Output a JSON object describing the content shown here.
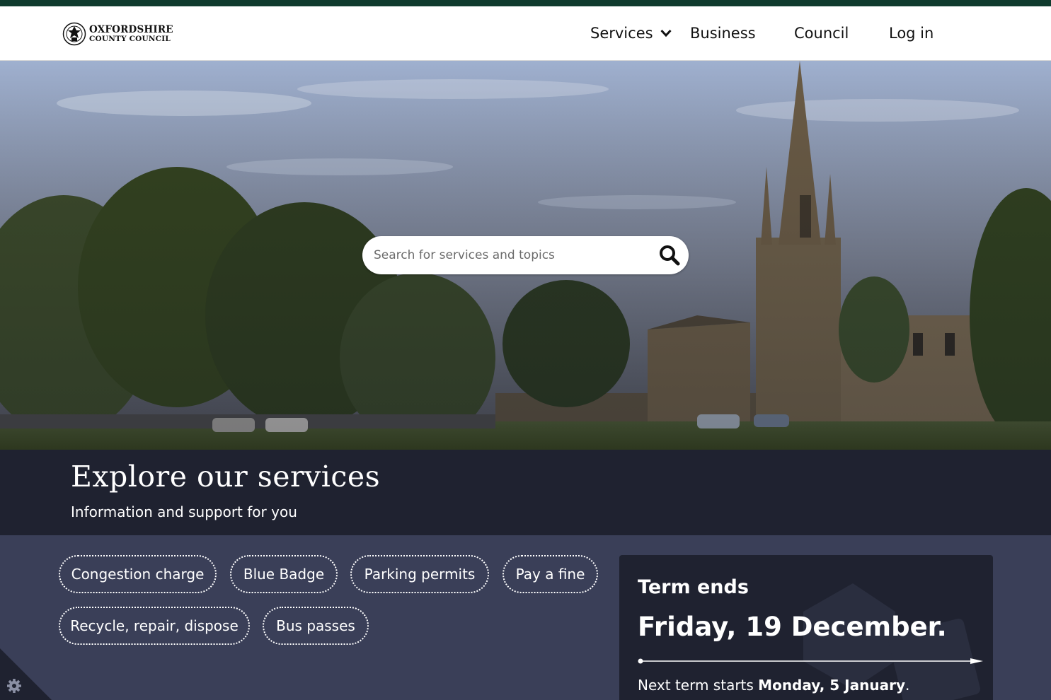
{
  "brand": {
    "name_line1": "OXFORDSHIRE",
    "name_line2": "COUNTY COUNCIL",
    "color": "#0f3b2e"
  },
  "nav": {
    "services": "Services",
    "business": "Business",
    "council": "Council",
    "login": "Log in"
  },
  "search": {
    "placeholder": "Search for services and topics"
  },
  "explore": {
    "title": "Explore our services",
    "subtitle": "Information and support for you"
  },
  "quick_links": [
    "Congestion charge",
    "Blue Badge",
    "Parking permits",
    "Pay a fine",
    "Recycle, repair, dispose",
    "Bus passes"
  ],
  "term": {
    "title": "Term ends",
    "date": "Friday, 19 December.",
    "next_prefix": "Next term starts",
    "next_date": "Monday, 5 January",
    "next_suffix": "."
  },
  "colors": {
    "explore_bg": "#1f2230",
    "services_bg": "#3a3f58",
    "card_bg": "#1f2230"
  },
  "icons": {
    "search": "search-icon",
    "chevron": "chevron-down-icon",
    "cookie": "gear-icon"
  }
}
